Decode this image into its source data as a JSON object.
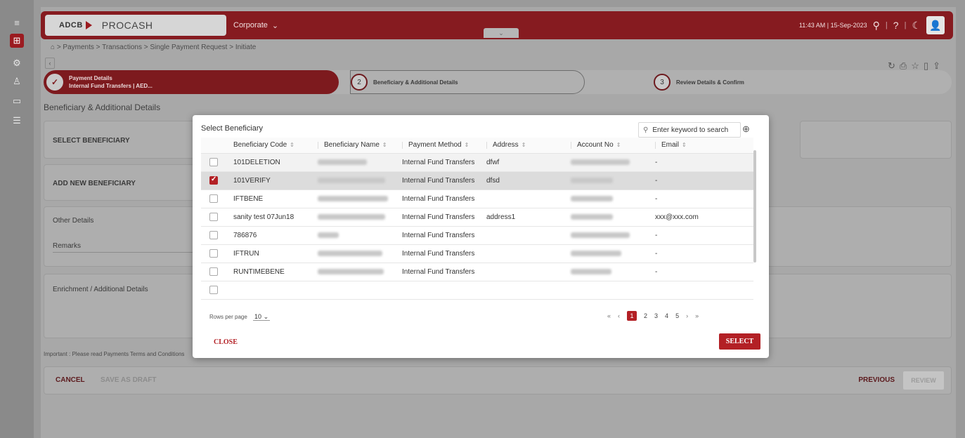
{
  "rail": {
    "menu_icon": "hamburger-icon",
    "items": [
      "dashboard-icon",
      "settings-icon",
      "user-icon",
      "payments-icon",
      "reports-icon"
    ]
  },
  "header": {
    "bank": "ADCB",
    "product": "PROCASH",
    "entity": "Corporate",
    "datetime": "11:43 AM | 15-Sep-2023"
  },
  "breadcrumb": "⌂ > Payments > Transactions > Single Payment Request > Initiate",
  "stepper": {
    "step1_title": "Payment Details",
    "step1_sub": "Internal Fund Transfers | AED...",
    "step2_num": "2",
    "step2_label": "Beneficiary & Additional Details",
    "step3_num": "3",
    "step3_label": "Review Details & Confirm"
  },
  "page": {
    "section_title": "Beneficiary & Additional Details",
    "select_beneficiary": "SELECT BENEFICIARY",
    "add_new_beneficiary": "ADD NEW BENEFICIARY",
    "other_details": "Other Details",
    "remarks": "Remarks",
    "enrichment": "Enrichment / Additional Details",
    "important": "Important : Please read Payments Terms and Conditions",
    "cancel": "CANCEL",
    "save_draft": "SAVE AS DRAFT",
    "previous": "PREVIOUS",
    "review": "REVIEW"
  },
  "modal": {
    "title": "Select Beneficiary",
    "search_placeholder": "Enter keyword to search",
    "columns": [
      "Beneficiary Code",
      "Beneficiary Name",
      "Payment Method",
      "Address",
      "Account No",
      "Email"
    ],
    "rows": [
      {
        "checked": false,
        "code": "101DELETION",
        "method": "Internal Fund Transfers",
        "address": "dfwf",
        "email": "-"
      },
      {
        "checked": true,
        "code": "101VERIFY",
        "method": "Internal Fund Transfers",
        "address": "dfsd",
        "email": "-"
      },
      {
        "checked": false,
        "code": "IFTBENE",
        "method": "Internal Fund Transfers",
        "address": "",
        "email": "-"
      },
      {
        "checked": false,
        "code": "sanity test 07Jun18",
        "method": "Internal Fund Transfers",
        "address": "address1",
        "email": "xxx@xxx.com"
      },
      {
        "checked": false,
        "code": "786876",
        "method": "Internal Fund Transfers",
        "address": "",
        "email": "-"
      },
      {
        "checked": false,
        "code": "IFTRUN",
        "method": "Internal Fund Transfers",
        "address": "",
        "email": "-"
      },
      {
        "checked": false,
        "code": "RUNTIMEBENE",
        "method": "Internal Fund Transfers",
        "address": "",
        "email": "-"
      }
    ],
    "rows_per_page_label": "Rows per page",
    "rows_per_page": "10",
    "pages": [
      "1",
      "2",
      "3",
      "4",
      "5"
    ],
    "current_page": "1",
    "close": "CLOSE",
    "select": "SELECT"
  },
  "colors": {
    "brand": "#9b1b20",
    "accent": "#b32025"
  }
}
